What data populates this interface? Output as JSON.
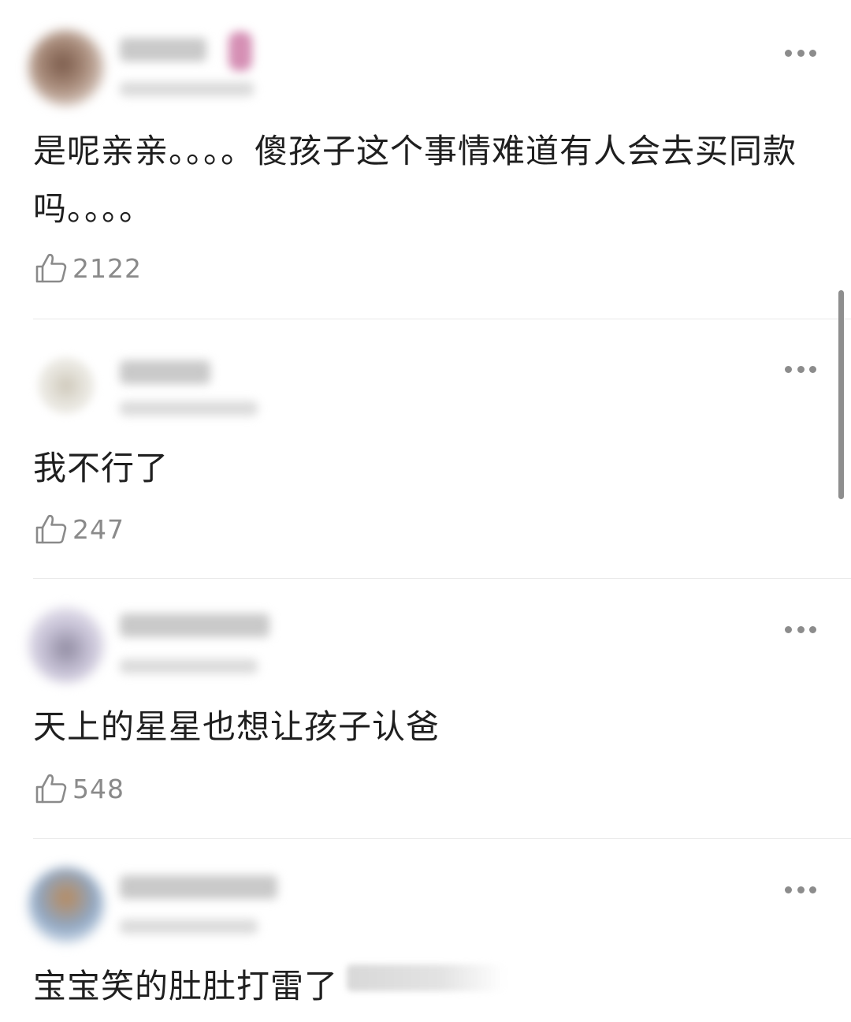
{
  "comments": [
    {
      "text": "是呢亲亲。。。。傻孩子这个事情难道有人会去买同款吗。。。。",
      "likes": "2122",
      "avatar_icon": "user-avatar-blurred",
      "like_icon": "thumbs-up-icon",
      "more_icon": "more-options-icon"
    },
    {
      "text": "我不行了",
      "likes": "247",
      "avatar_icon": "user-avatar-blurred",
      "like_icon": "thumbs-up-icon",
      "more_icon": "more-options-icon"
    },
    {
      "text": "天上的星星也想让孩子认爸",
      "likes": "548",
      "avatar_icon": "user-avatar-blurred",
      "like_icon": "thumbs-up-icon",
      "more_icon": "more-options-icon"
    },
    {
      "text": "宝宝笑的肚肚打雷了",
      "avatar_icon": "user-avatar-blurred",
      "more_icon": "more-options-icon"
    }
  ],
  "colors": {
    "text": "#1f1f1f",
    "muted": "#8a8a8a",
    "divider": "#e9e9e9",
    "background": "#ffffff"
  }
}
